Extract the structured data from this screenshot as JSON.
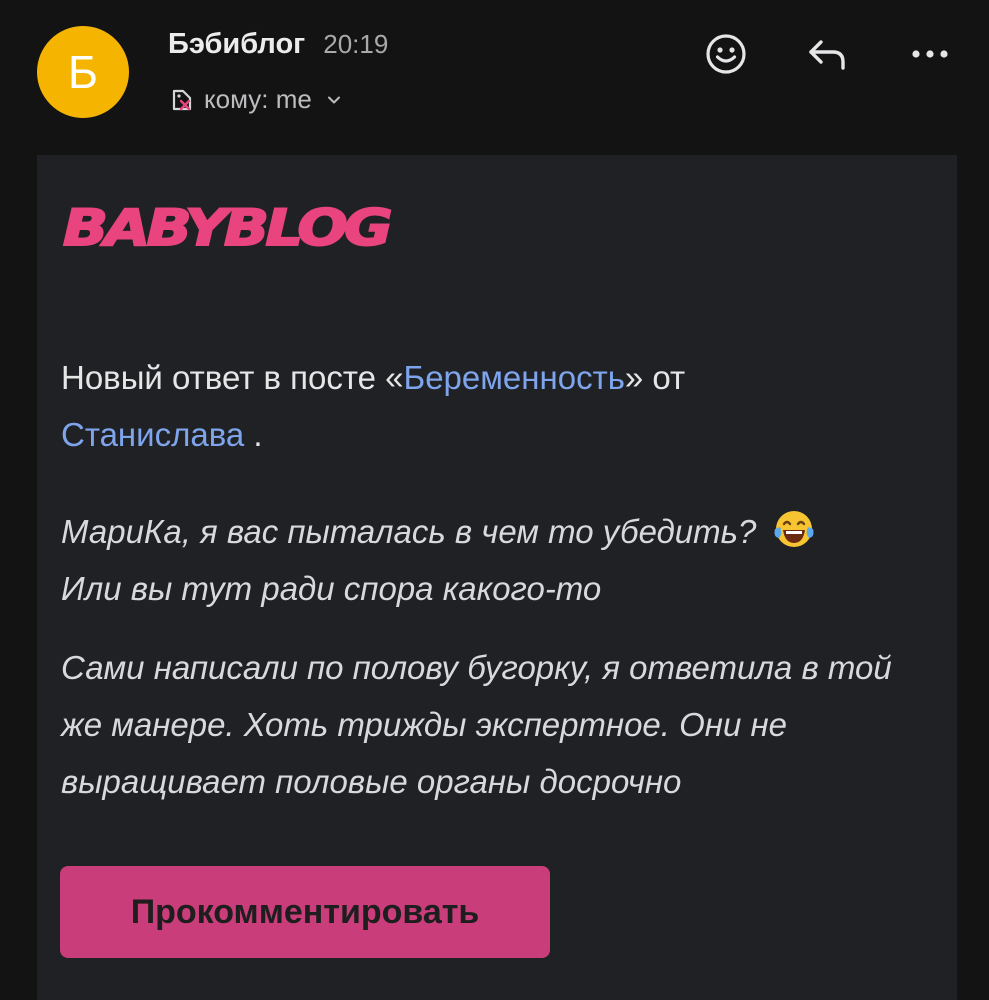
{
  "header": {
    "avatar_letter": "Б",
    "sender_name": "Бэбиблог",
    "time": "20:19",
    "recipient": "кому: me",
    "icons": [
      "smile-icon",
      "reply-icon",
      "more-icon"
    ]
  },
  "email": {
    "logo_text": "BABYBLOG",
    "notice": {
      "prefix": "Новый ответ в посте «",
      "post_link": "Беременность",
      "middle": "» от",
      "author_link": "Станислава",
      "suffix": " ."
    },
    "quote": [
      "МариКа, я вас пыталась в чем то убедить?",
      "Или вы тут ради спора какого-то",
      "Сами написали по полову бугорку, я ответила в той же манере. Хоть трижды экспертное. Они не выращивает половые органы досрочно"
    ],
    "button_label": "Прокомментировать"
  },
  "colors": {
    "background": "#131314",
    "card": "#202124",
    "avatar": "#f4b400",
    "link": "#7ea4ec",
    "button": "#c93d7b",
    "logo": "#e9447e"
  }
}
